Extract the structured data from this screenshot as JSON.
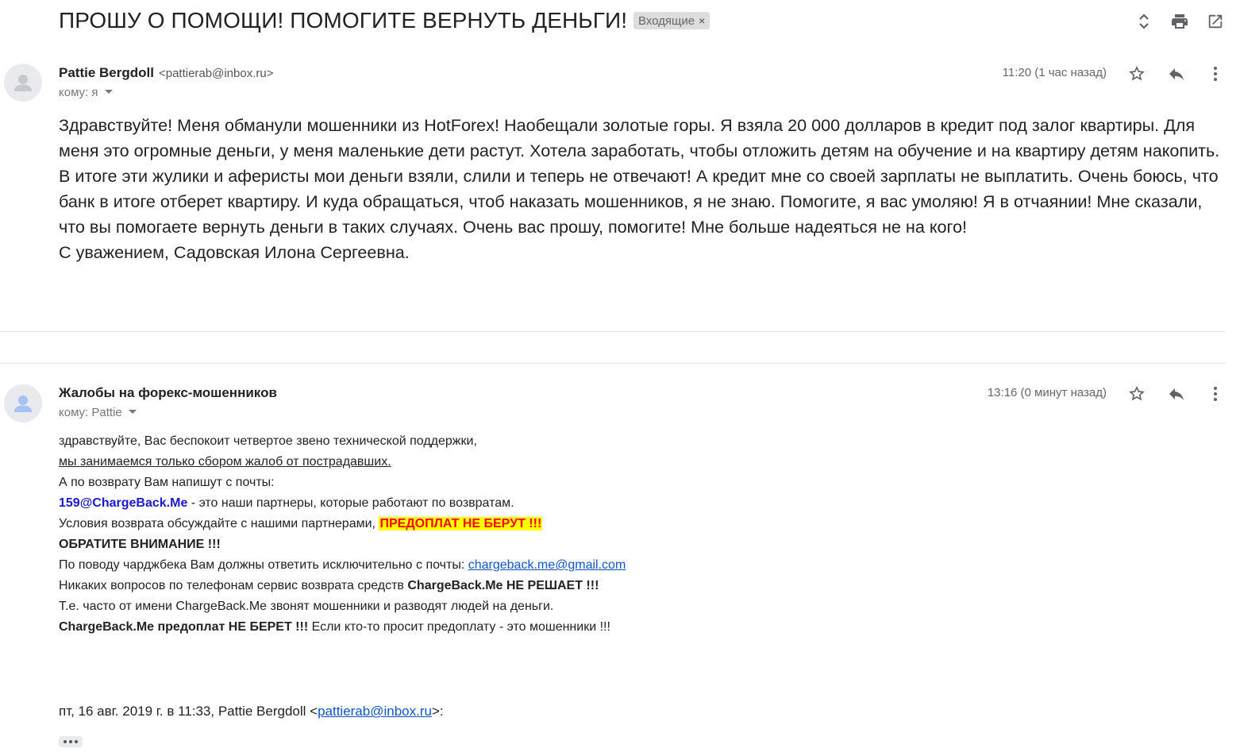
{
  "subject": "ПРОШУ О ПОМОЩИ! ПОМОГИТЕ ВЕРНУТЬ ДЕНЬГИ!",
  "label": "Входящие",
  "label_close": "×",
  "toolbar_icons": [
    "expand-collapse-icon",
    "print-icon",
    "open-new-window-icon"
  ],
  "message1": {
    "sender_name": "Pattie Bergdoll",
    "sender_email": "<pattierab@inbox.ru>",
    "to": "кому: я",
    "time": "11:20 (1 час назад)",
    "icons": [
      "star-icon",
      "reply-icon",
      "more-vert-icon"
    ],
    "body": [
      "Здравствуйте! Меня обманули мошенники из HotForex! Наобещали золотые горы. Я взяла 20 000 долларов в кредит под залог квартиры. Для меня это огромные деньги, у меня маленькие дети растут. Хотела заработать, чтобы отложить детям на обучение и на квартиру детям накопить. В итоге эти жулики и аферисты мои деньги взяли, слили и теперь не отвечают! А кредит мне со своей зарплаты не выплатить. Очень боюсь, что банк в итоге отберет квартиру. И куда обращаться, чтоб наказать мошенников, я не знаю. Помогите, я вас умоляю! Я в отчаянии! Мне сказали, что вы помогаете вернуть деньги в таких случаях. Очень вас прошу, помогите! Мне больше надеяться не на кого!",
      "С уважением, Садовская Илона Сергеевна."
    ]
  },
  "message2": {
    "sender_name": "Жалобы на форекс-мошенников",
    "to": "кому: Pattie",
    "time": "13:16 (0 минут назад)",
    "icons": [
      "star-icon",
      "reply-icon",
      "more-vert-icon"
    ],
    "lines": {
      "l1": "здравствуйте, Вас беспокоит четвертое звено технической поддержки,",
      "l2": "мы занимаемся только сбором жалоб от пострадавших.",
      "l3": "А по возврату Вам напишут с почты:",
      "l4_email": "159@ChargeBack.Me",
      "l4_rest": " - это наши партнеры, которые работают по возвратам.",
      "l5_text": "Условия возврата обсуждайте с нашими партнерами, ",
      "l5_highlight": "ПРЕДОПЛАТ НЕ БЕРУТ !!!",
      "l6": "ОБРАТИТЕ ВНИМАНИЕ !!!",
      "l7_text": "По поводу чарджбека Вам должны ответить исключительно с почты: ",
      "l7_link": "chargeback.me@gmail.com",
      "l8_text": "Никаких вопросов по телефонам сервис возврата средств ",
      "l8_bold": "ChargeBack.Me НЕ РЕШАЕТ !!!",
      "l9": "Т.е. часто от имени ChargeBack.Me звонят мошенники и разводят людей на деньги.",
      "l10_bold": "ChargeBack.Me предоплат НЕ БЕРЕТ !!!",
      "l10_rest": " Если кто-то просит предоплату - это мошенники !!!"
    },
    "quote_prefix": "пт, 16 авг. 2019 г. в 11:33, Pattie Bergdoll <",
    "quote_email": "pattierab@inbox.ru",
    "quote_suffix": ">:"
  },
  "colors": {
    "highlight_bg": "#ffff00",
    "highlight_text": "#ff0000",
    "partner_email": "#1a1acc",
    "link": "#1155cc"
  }
}
